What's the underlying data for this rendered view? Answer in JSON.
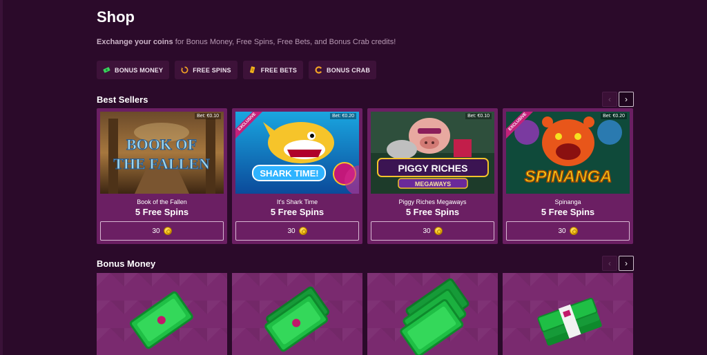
{
  "page": {
    "title": "Shop",
    "subtitle_strong": "Exchange your coins",
    "subtitle_rest": " for Bonus Money, Free Spins, Free Bets, and Bonus Crab credits!"
  },
  "filters": [
    {
      "label": "BONUS MONEY",
      "icon": "money-icon"
    },
    {
      "label": "FREE SPINS",
      "icon": "spin-icon"
    },
    {
      "label": "FREE BETS",
      "icon": "ticket-icon"
    },
    {
      "label": "BONUS CRAB",
      "icon": "crab-icon"
    }
  ],
  "best_sellers": {
    "title": "Best Sellers",
    "cards": [
      {
        "bet": "Bet: €0.10",
        "name": "Book of the Fallen",
        "reward": "5 Free Spins",
        "price": "30",
        "exclusive": false,
        "art_text": "BOOK OF THE FALLEN"
      },
      {
        "bet": "Bet: €0.20",
        "name": "It's Shark Time",
        "reward": "5 Free Spins",
        "price": "30",
        "exclusive": true,
        "exclusive_label": "EXCLUSIVE",
        "art_text": "SHARK TIME!"
      },
      {
        "bet": "Bet: €0.10",
        "name": "Piggy Riches Megaways",
        "reward": "5 Free Spins",
        "price": "30",
        "exclusive": false,
        "art_text": "PIGGY RICHES",
        "art_sub": "MEGAWAYS"
      },
      {
        "bet": "Bet: €0.20",
        "name": "Spinanga",
        "reward": "5 Free Spins",
        "price": "30",
        "exclusive": true,
        "exclusive_label": "EXCLUSIVE",
        "art_text": "SPINANGA"
      }
    ]
  },
  "bonus_money": {
    "title": "Bonus Money"
  },
  "nav": {
    "prev": "‹",
    "next": "›"
  },
  "colors": {
    "background": "#2b0a2a",
    "card": "#6b1f63",
    "chip": "#3d1239",
    "money_green": "#22c84a"
  }
}
